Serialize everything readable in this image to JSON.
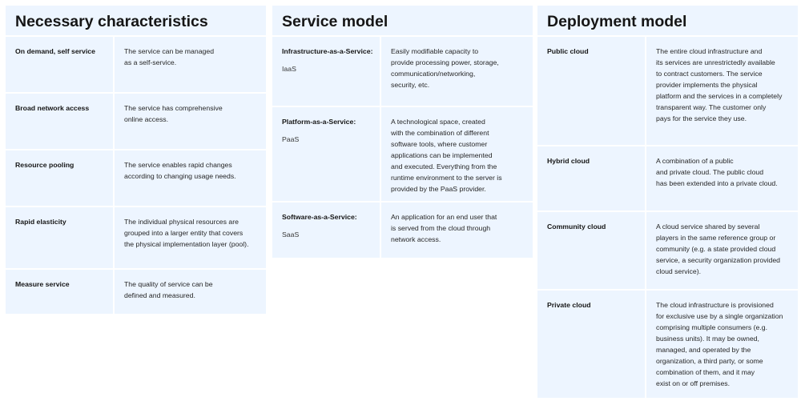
{
  "characteristics": {
    "title": "Necessary characteristics",
    "rows": [
      {
        "term": "On demand, self service",
        "desc": "The service can be managed\nas a self-service."
      },
      {
        "term": "Broad network access",
        "desc": "The service has comprehensive\nonline access."
      },
      {
        "term": "Resource pooling",
        "desc": "The service enables rapid changes\naccording to changing usage needs."
      },
      {
        "term": "Rapid elasticity",
        "desc": "The individual physical resources are\ngrouped into a larger entity that covers\nthe physical implementation layer (pool)."
      },
      {
        "term": "Measure service",
        "desc": "The quality of service can be\ndefined and measured."
      }
    ]
  },
  "service_model": {
    "title": "Service model",
    "rows": [
      {
        "term": "Infrastructure-as-a-Service:",
        "abbr": "IaaS",
        "desc": "Easily modifiable capacity to\nprovide processing power, storage,\ncommunication/networking,\nsecurity, etc."
      },
      {
        "term": "Platform-as-a-Service:",
        "abbr": "PaaS",
        "desc": "A technological space, created\nwith the combination of different\nsoftware tools, where customer\napplications can be implemented\nand executed. Everything from the\nruntime environment to the server is\nprovided by the PaaS provider."
      },
      {
        "term": "Software-as-a-Service:",
        "abbr": "SaaS",
        "desc": "An application for an end user that\nis served from the cloud through\nnetwork access."
      }
    ]
  },
  "deployment_model": {
    "title": "Deployment model",
    "rows": [
      {
        "term": "Public cloud",
        "desc": "The entire cloud infrastructure and\nits services are unrestrictedly available\nto contract customers. The service\nprovider implements the physical\nplatform and the services in a completely\ntransparent way. The customer only\npays for the service they use."
      },
      {
        "term": "Hybrid cloud",
        "desc": "A combination of a public\nand private cloud. The public cloud\nhas been extended into a private cloud."
      },
      {
        "term": "Community cloud",
        "desc": "A cloud service shared by several\nplayers in the same reference group or\ncommunity (e.g. a state provided cloud\nservice, a security organization provided\ncloud service)."
      },
      {
        "term": "Private cloud",
        "desc": "The cloud infrastructure is provisioned\nfor exclusive use by a single organization\ncomprising multiple consumers (e.g.\nbusiness units). It may be owned,\nmanaged, and operated by the\norganization, a third party, or some\ncombination of them, and it may\nexist on or off premises."
      }
    ]
  }
}
